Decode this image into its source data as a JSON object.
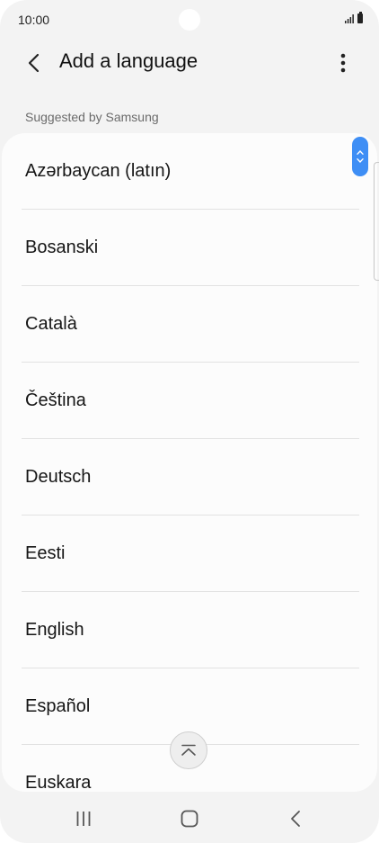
{
  "status_bar": {
    "time": "10:00"
  },
  "app_bar": {
    "title": "Add a language"
  },
  "section": {
    "header": "Suggested by Samsung"
  },
  "languages": [
    "Azərbaycan (latın)",
    "Bosanski",
    "Català",
    "Čeština",
    "Deutsch",
    "Eesti",
    "English",
    "Español",
    "Euskara"
  ],
  "colors": {
    "accent": "#3e8ef5",
    "background": "#f3f3f3",
    "card": "#fcfcfc"
  },
  "icons": {
    "back": "chevron-left-icon",
    "more": "more-vertical-icon",
    "scroll_to_top": "chevron-up-icon",
    "nav_recents": "recents-icon",
    "nav_home": "home-icon",
    "nav_back": "back-icon"
  }
}
